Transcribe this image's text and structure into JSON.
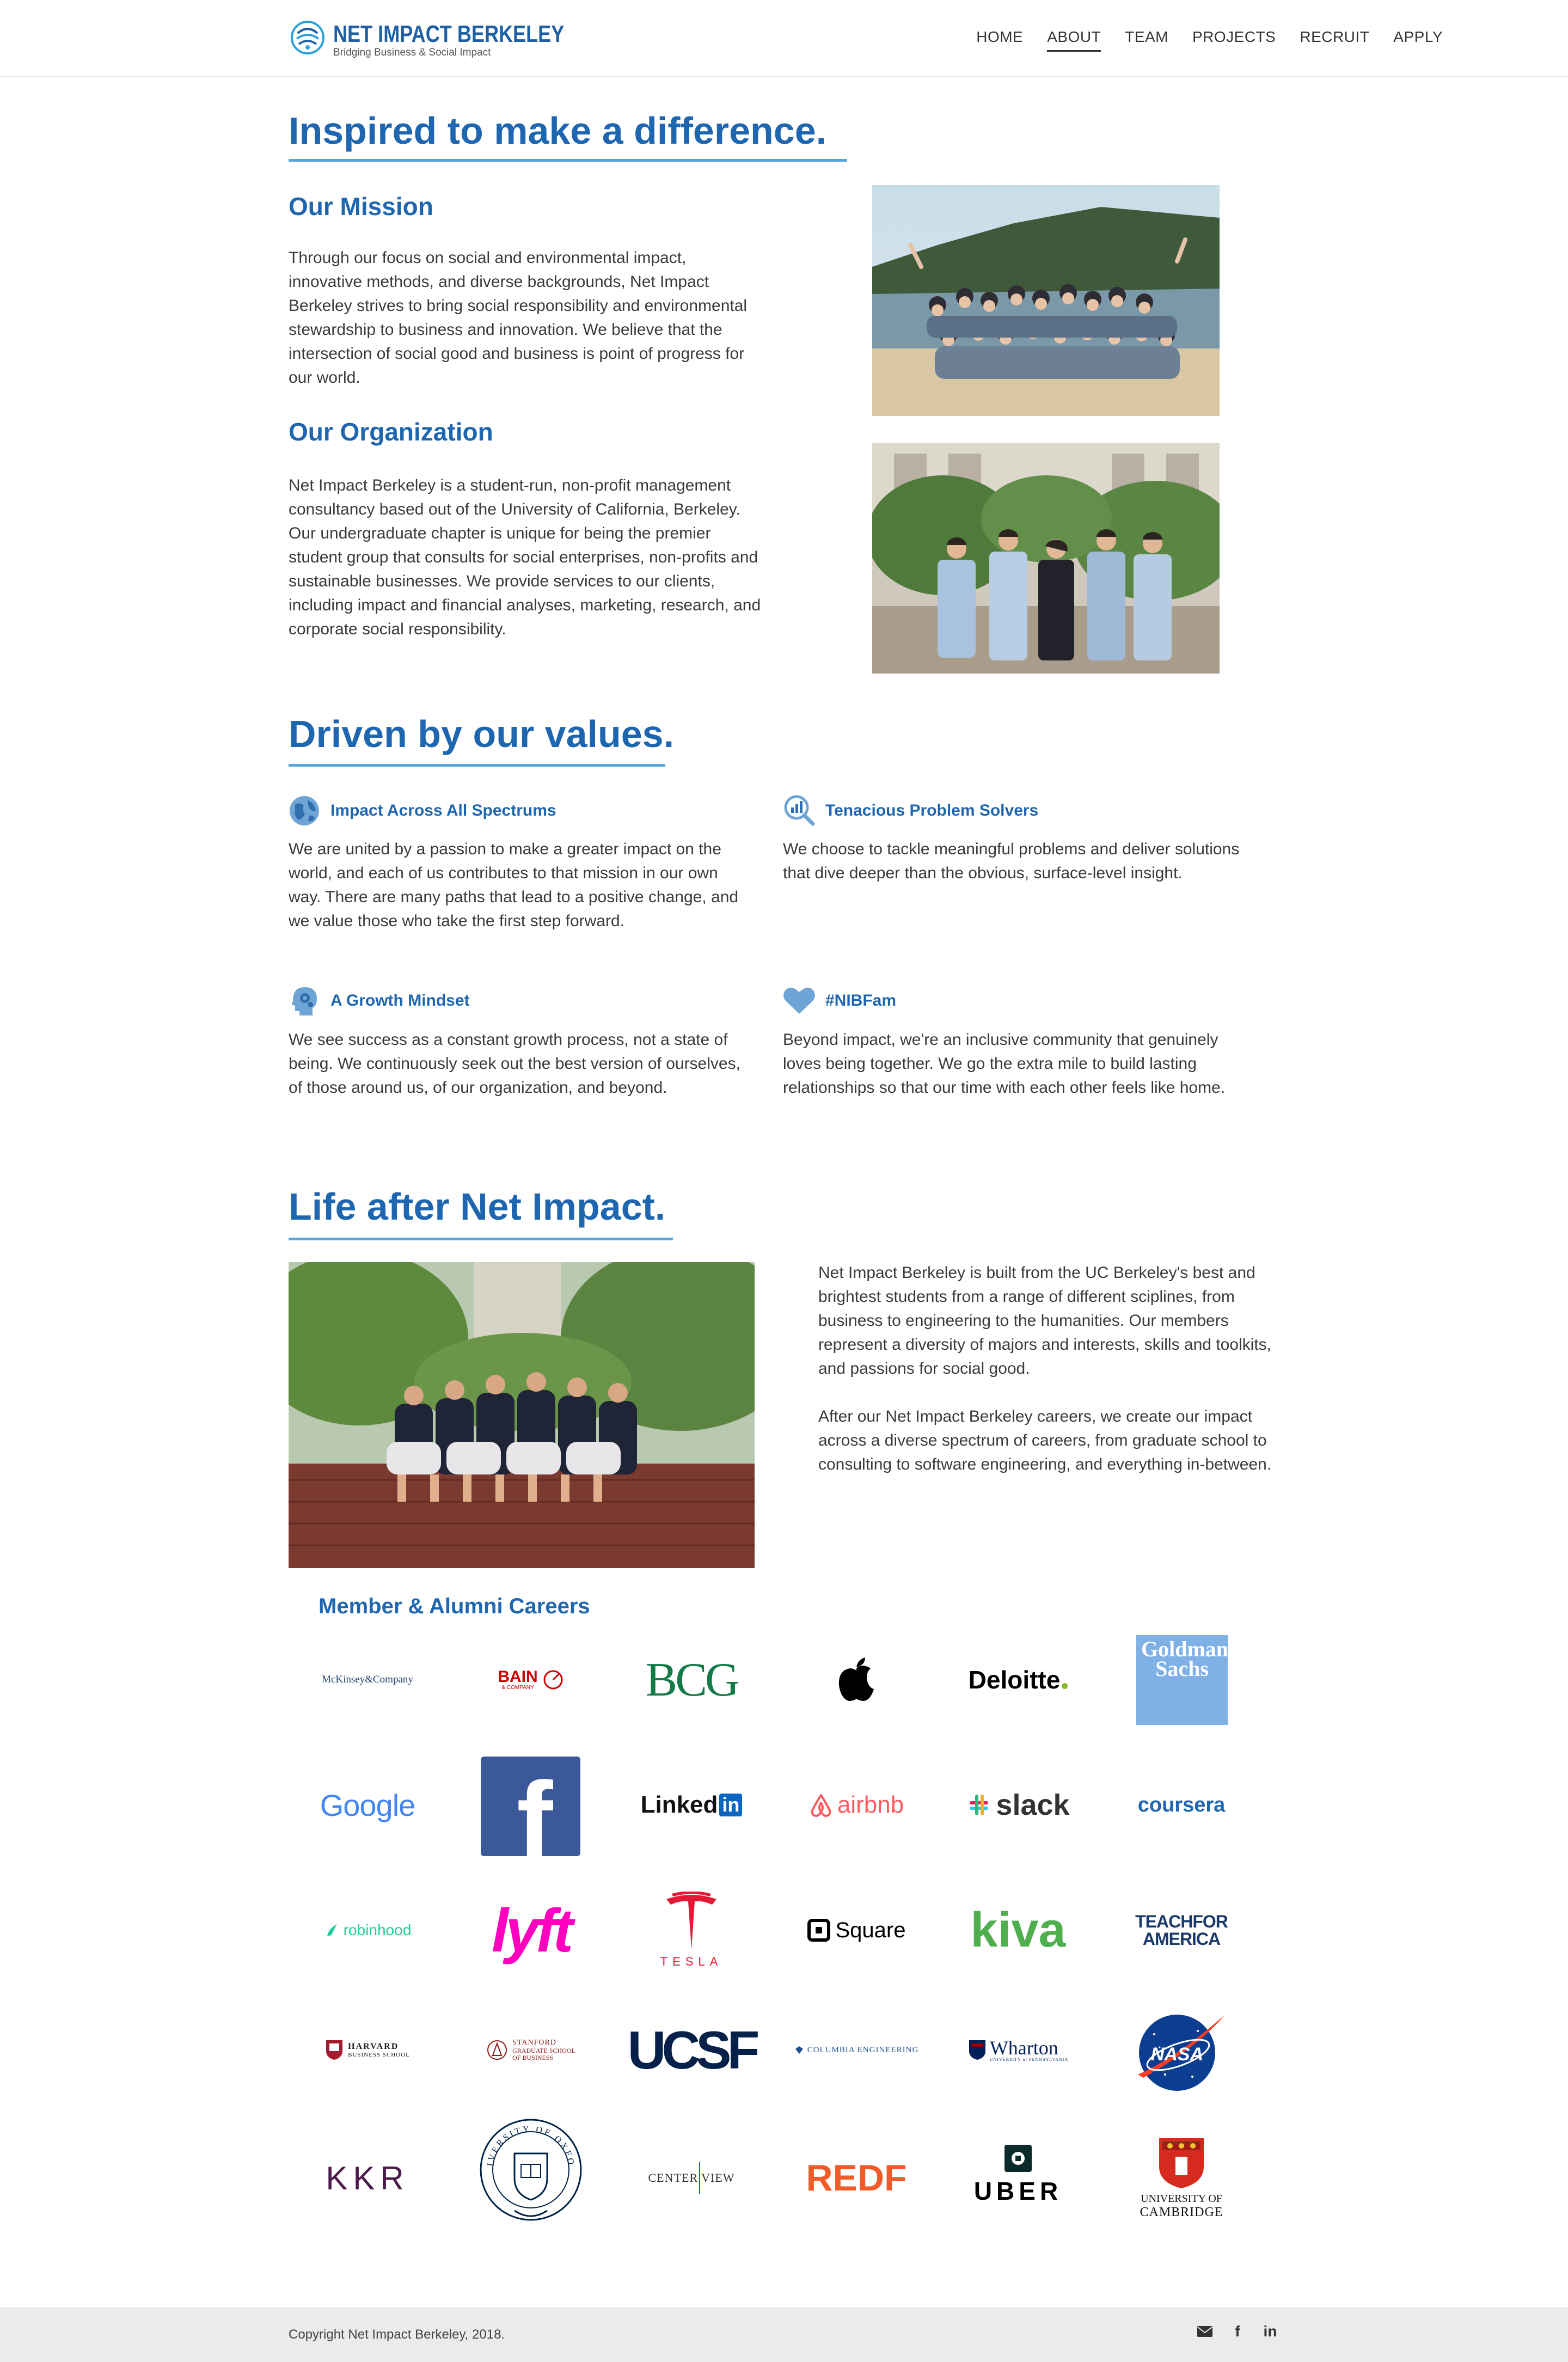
{
  "brand": {
    "name": "NET IMPACT BERKELEY",
    "tagline": "Bridging Business & Social Impact"
  },
  "nav": {
    "items": [
      {
        "label": "HOME",
        "active": false
      },
      {
        "label": "ABOUT",
        "active": true
      },
      {
        "label": "TEAM",
        "active": false
      },
      {
        "label": "PROJECTS",
        "active": false
      },
      {
        "label": "RECRUIT",
        "active": false
      },
      {
        "label": "APPLY",
        "active": false
      }
    ]
  },
  "intro": {
    "heading": "Inspired to make a difference.",
    "mission_title": "Our Mission",
    "mission_text": "Through our focus on social and environmental impact, innovative methods, and diverse backgrounds, Net Impact Berkeley strives to bring social responsibility and environmental stewardship to business and innovation. We believe that the intersection of social good and business is point of progress for our world.",
    "org_title": "Our Organization",
    "org_text": "Net Impact Berkeley is a student-run, non-profit management consultancy based out of the University of California, Berkeley. Our undergraduate chapter is unique for being the premier student group that consults for social enterprises, non-profits and sustainable businesses. We provide services to our clients, including impact and financial analyses, marketing, research, and corporate social responsibility."
  },
  "values": {
    "heading": "Driven by our values.",
    "items": [
      {
        "icon": "globe-icon",
        "title": "Impact Across All Spectrums",
        "text": "We are united by a passion to make a greater impact on the world, and each of us contributes to that mission in our own way. There are many paths that lead to a positive change, and we value those who take the first step forward."
      },
      {
        "icon": "magnifier-chart-icon",
        "title": "Tenacious Problem Solvers",
        "text": "We choose to tackle meaningful problems and deliver solutions that dive deeper than the obvious, surface-level insight."
      },
      {
        "icon": "head-gears-icon",
        "title": "A Growth Mindset",
        "text": "We see success as a constant growth process, not a state of being. We continuously seek out the best version of ourselves, of those around us, of our organization, and beyond."
      },
      {
        "icon": "heart-icon",
        "title": "#NIBFam",
        "text": "Beyond impact, we're an inclusive community that genuinely loves being together. We go the extra mile to build lasting relationships so that our time with each other feels like home."
      }
    ]
  },
  "life": {
    "heading": "Life after Net Impact.",
    "para1": "Net Impact Berkeley is built from the UC Berkeley's best and brightest students from a range of different sciplines, from business to engineering to the humanities. Our members represent a diversity of majors and interests, skills and toolkits, and passions for social good.",
    "para2": "After our Net Impact Berkeley careers, we create our impact across a diverse spectrum of careers, from graduate school to consulting to software engineering, and everything in-between."
  },
  "careers": {
    "title": "Member & Alumni Careers",
    "logos": {
      "mckinsey": "McKinsey&Company",
      "bain": "BAIN",
      "bain_sub": "& COMPANY",
      "bcg": "BCG",
      "deloitte": "Deloitte",
      "goldman": "Goldman Sachs",
      "google": "Google",
      "facebook": "f",
      "linkedin": "Linked",
      "linkedin_in": "in",
      "airbnb": "airbnb",
      "slack": "slack",
      "coursera": "coursera",
      "robinhood": "robinhood",
      "lyft": "lyft",
      "tesla": "TESLA",
      "square": "Square",
      "kiva": "kiva",
      "tfa1": "TEACHFOR",
      "tfa2": "AMERICA",
      "hbs1": "HARVARD",
      "hbs2": "BUSINESS SCHOOL",
      "stanford1": "STANFORD",
      "stanford2": "GRADUATE SCHOOL",
      "stanford3": "OF BUSINESS",
      "ucsf": "UCSF",
      "columbia": "COLUMBIA ENGINEERING",
      "wharton": "Wharton",
      "wharton_sub": "UNIVERSITY of PENNSYLVANIA",
      "nasa": "NASA",
      "kkr": "KKR",
      "oxford": "UNIVERSITY OF OXFORD",
      "centerview1": "CENTER",
      "centerview2": "VIEW",
      "redf": "REDF",
      "uber": "UBER",
      "cambridge1": "UNIVERSITY OF",
      "cambridge2": "CAMBRIDGE"
    }
  },
  "footer": {
    "copyright": "Copyright Net Impact Berkeley, 2018.",
    "icons": [
      "email-icon",
      "facebook-icon",
      "linkedin-icon"
    ],
    "fb_glyph": "f",
    "in_glyph": "in"
  },
  "colors": {
    "accent": "#1f66b0",
    "rule": "#5aa4dc",
    "footer_bg": "#ebebeb"
  }
}
